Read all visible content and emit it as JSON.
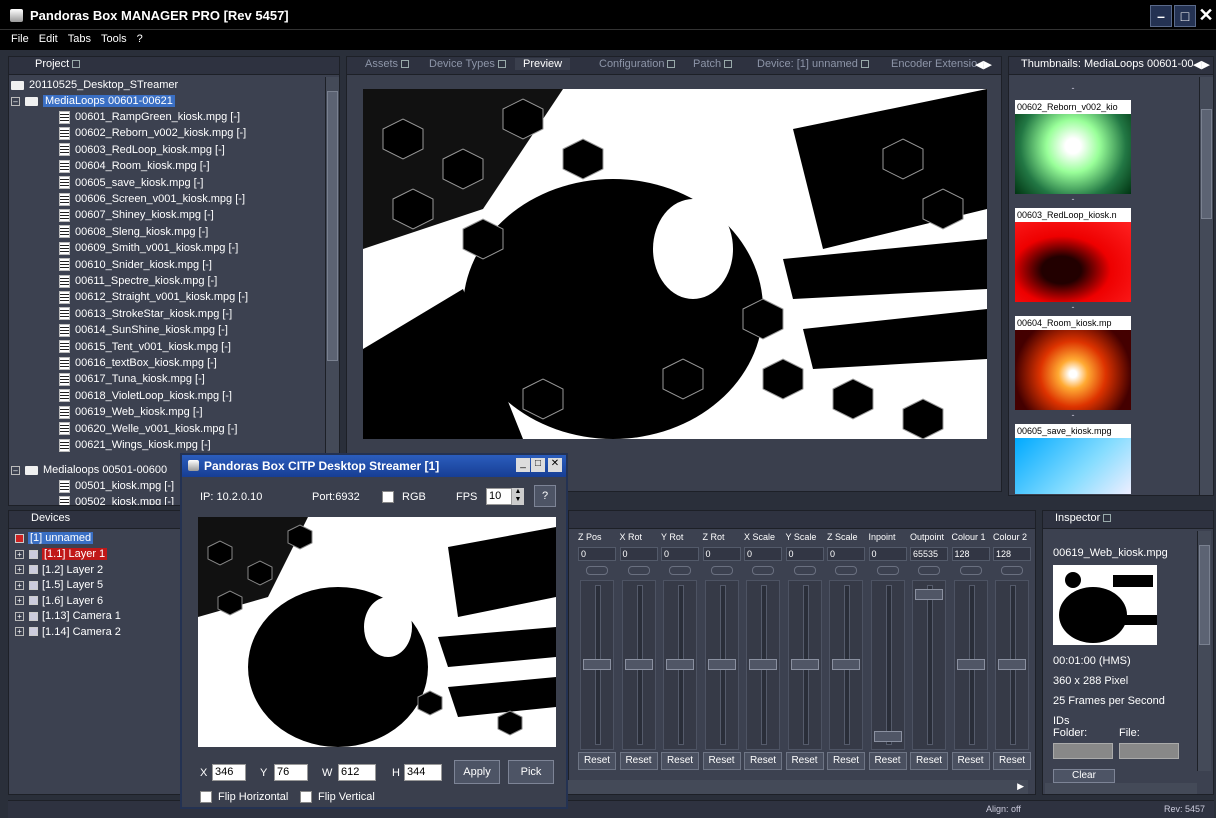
{
  "app": {
    "title": "Pandoras Box MANAGER PRO [Rev 5457]",
    "menu": [
      "File",
      "Edit",
      "Tabs",
      "Tools",
      "?"
    ]
  },
  "project": {
    "tab": "Project",
    "root": "20110525_Desktop_STreamer",
    "folder1": "MediaLoops 00601-00621",
    "files": [
      "00601_RampGreen_kiosk.mpg [-]",
      "00602_Reborn_v002_kiosk.mpg [-]",
      "00603_RedLoop_kiosk.mpg [-]",
      "00604_Room_kiosk.mpg [-]",
      "00605_save_kiosk.mpg [-]",
      "00606_Screen_v001_kiosk.mpg [-]",
      "00607_Shiney_kiosk.mpg [-]",
      "00608_Sleng_kiosk.mpg [-]",
      "00609_Smith_v001_kiosk.mpg [-]",
      "00610_Snider_kiosk.mpg [-]",
      "00611_Spectre_kiosk.mpg [-]",
      "00612_Straight_v001_kiosk.mpg [-]",
      "00613_StrokeStar_kiosk.mpg [-]",
      "00614_SunShine_kiosk.mpg [-]",
      "00615_Tent_v001_kiosk.mpg [-]",
      "00616_textBox_kiosk.mpg [-]",
      "00617_Tuna_kiosk.mpg [-]",
      "00618_VioletLoop_kiosk.mpg [-]",
      "00619_Web_kiosk.mpg [-]",
      "00620_Welle_v001_kiosk.mpg [-]",
      "00621_Wings_kiosk.mpg [-]"
    ],
    "folder2": "Medialoops 00501-00600",
    "files2": [
      "00501_kiosk.mpg [-]",
      "00502_kiosk.mpg [-]"
    ]
  },
  "center_tabs": [
    "Assets",
    "Device Types",
    "Preview",
    "Configuration",
    "Patch",
    "Device: [1] unnamed",
    "Encoder Extensio"
  ],
  "thumbnails": {
    "tab": "Thumbnails: MediaLoops 00601-00",
    "items": [
      "00602_Reborn_v002_kio",
      "00603_RedLoop_kiosk.n",
      "00604_Room_kiosk.mp",
      "00605_save_kiosk.mpg"
    ],
    "dash": "-"
  },
  "devices": {
    "tab": "Devices",
    "root": "[1] unnamed",
    "items": [
      "[1.1] Layer 1",
      "[1.2] Layer 2",
      "[1.5] Layer 5",
      "[1.6] Layer 6",
      "[1.13] Camera 1",
      "[1.14] Camera 2"
    ]
  },
  "params": {
    "columns": [
      "Z Pos",
      "X Rot",
      "Y Rot",
      "Z Rot",
      "X Scale",
      "Y Scale",
      "Z Scale",
      "Inpoint",
      "Outpoint",
      "Colour 1",
      "Colour 2"
    ],
    "values": [
      "0",
      "0",
      "0",
      "0",
      "0",
      "0",
      "0",
      "0",
      "65535",
      "128",
      "128"
    ],
    "reset": "Reset"
  },
  "inspector": {
    "tab": "Inspector",
    "file": "00619_Web_kiosk.mpg",
    "duration": "00:01:00 (HMS)",
    "resolution": "360 x 288 Pixel",
    "fps": "25 Frames per Second",
    "ids": "IDs",
    "folder": "Folder:",
    "filelbl": "File:",
    "clear": "Clear"
  },
  "streamer": {
    "title": "Pandoras Box CITP Desktop Streamer [1]",
    "ip": "IP: 10.2.0.10",
    "port": "Port:6932",
    "rgb": "RGB",
    "fps_label": "FPS",
    "fps": "10",
    "help": "?",
    "x_label": "X",
    "x": "346",
    "y_label": "Y",
    "y": "76",
    "w_label": "W",
    "w": "612",
    "h_label": "H",
    "h": "344",
    "apply": "Apply",
    "pick": "Pick",
    "flip_h": "Flip Horizontal",
    "flip_v": "Flip Vertical"
  },
  "status": {
    "align": "Align: off",
    "rev": "Rev: 5457"
  }
}
